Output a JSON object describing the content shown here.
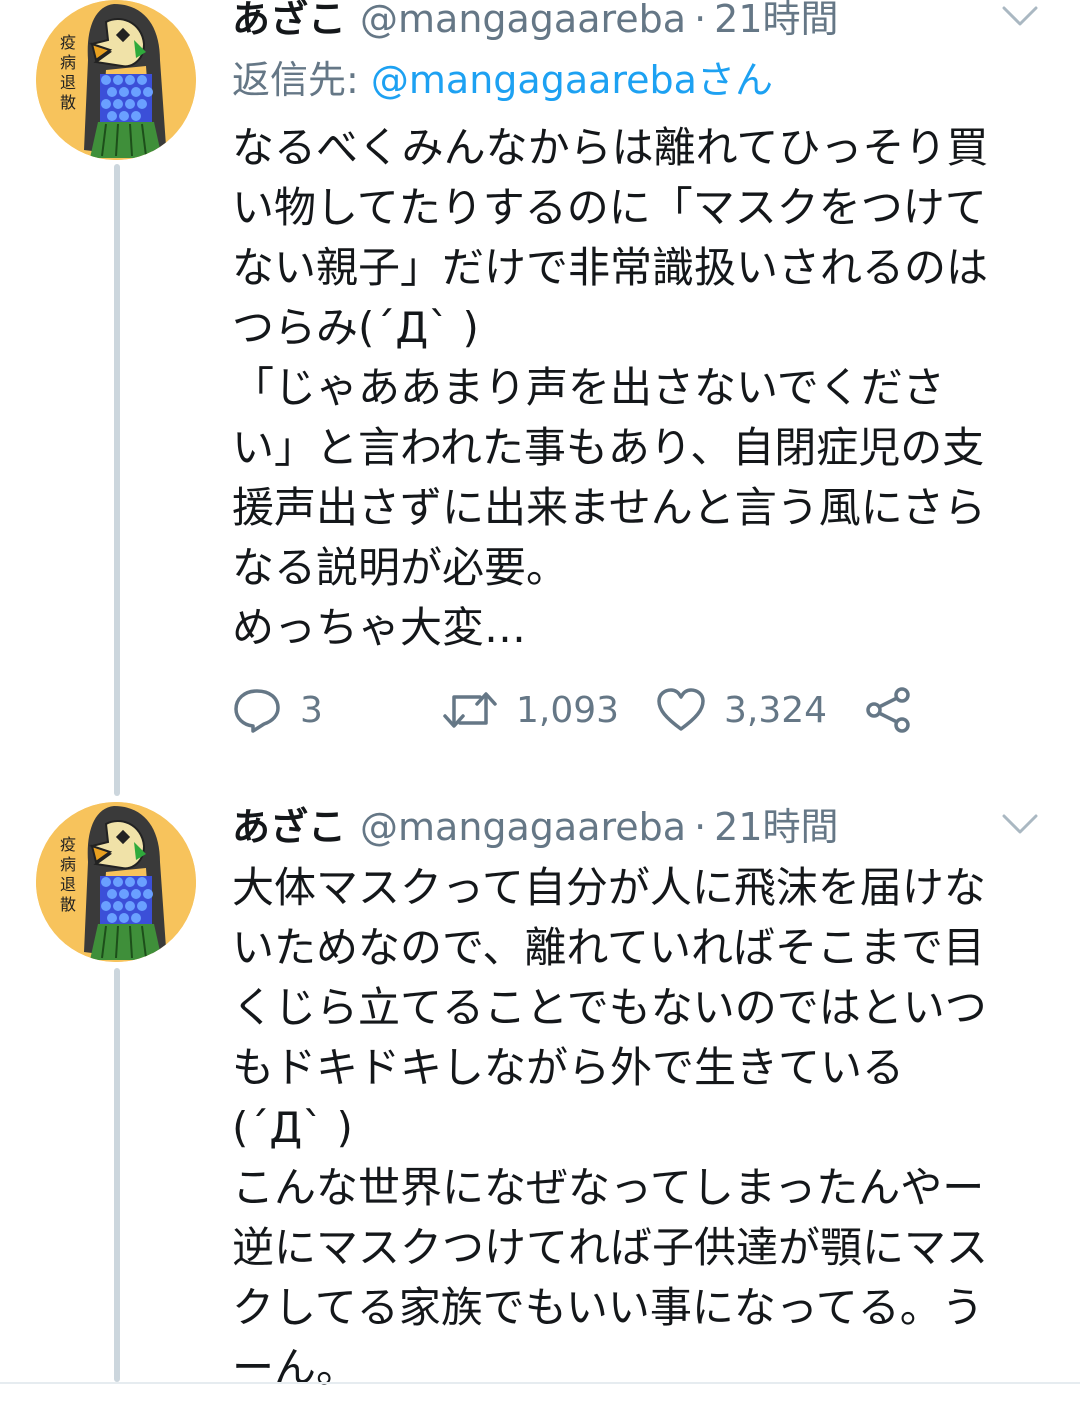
{
  "colors": {
    "text": "#14171a",
    "secondary": "#657786",
    "link": "#1da1f2",
    "thread_line": "#ccd6dd",
    "avatar_bg": "#f7c35c"
  },
  "icons": {
    "reply": "speech-bubble",
    "retweet": "retweet-arrows",
    "like": "heart",
    "share": "share-nodes",
    "caret": "chevron-down"
  },
  "tweets": [
    {
      "avatar_text": "疫病退散",
      "name": "あざこ",
      "handle": "@mangagaareba",
      "separator": "·",
      "time": "21時間",
      "reply_label": "返信先:",
      "reply_handle": "@mangagaarebaさん",
      "lines": [
        "なるべくみんなからは離れてひっそり買",
        "い物してたりするのに「マスクをつけて",
        "ない親子」だけで非常識扱いされるのは",
        "つらみ(´Д` )",
        "「じゃああまり声を出さないでくださ",
        "い」と言われた事もあり、自閉症児の支",
        "援声出さずに出来ませんと言う風にさら",
        "なる説明が必要。",
        "めっちゃ大変…"
      ],
      "stats": {
        "replies": "3",
        "retweets": "1,093",
        "likes": "3,324"
      }
    },
    {
      "avatar_text": "疫病退散",
      "name": "あざこ",
      "handle": "@mangagaareba",
      "separator": "·",
      "time": "21時間",
      "lines": [
        "大体マスクって自分が人に飛沫を届けな",
        "いためなので、離れていればそこまで目",
        "くじら立てることでもないのではといつ",
        "もドキドキしながら外で生きている",
        "(´Д` )",
        "こんな世界になぜなってしまったんやー",
        "逆にマスクつけてれば子供達が顎にマス",
        "クしてる家族でもいい事になってる。う",
        "ーん。"
      ]
    }
  ]
}
